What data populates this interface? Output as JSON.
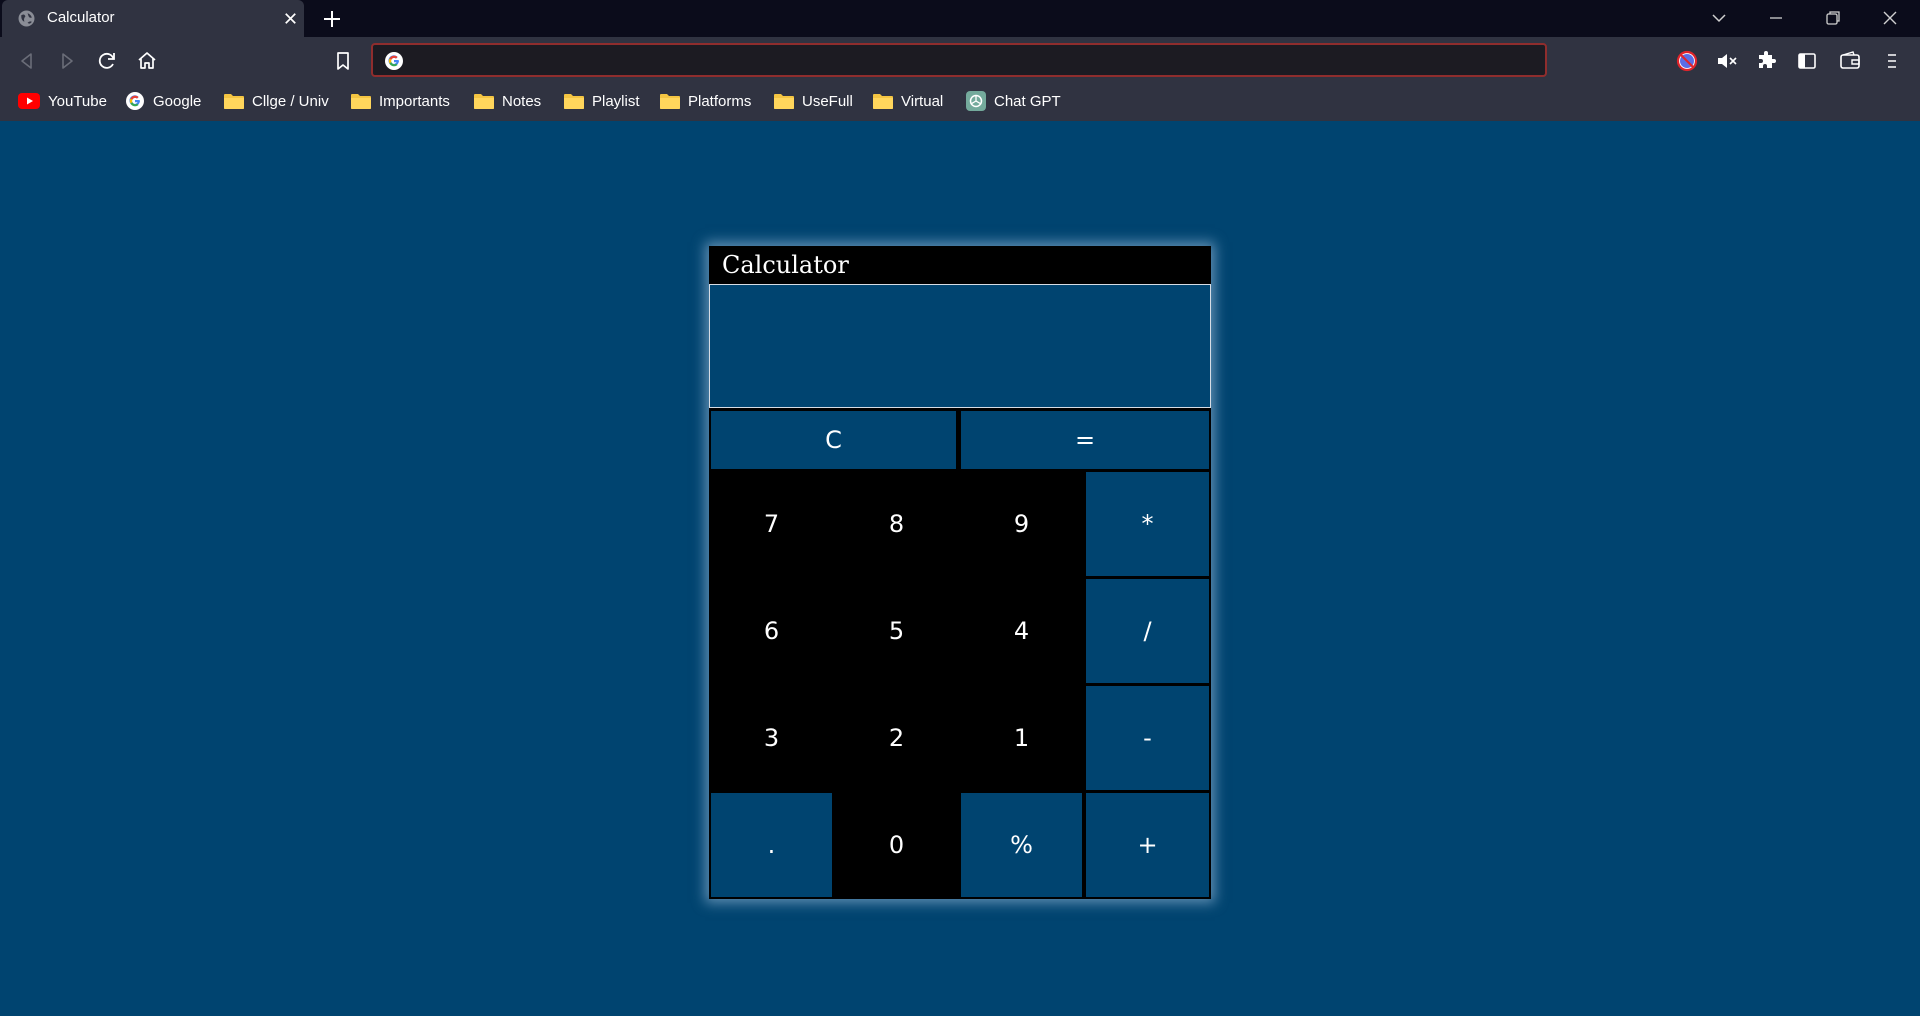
{
  "browser": {
    "tab_title": "Calculator",
    "address_value": "",
    "address_placeholder": "",
    "bookmarks": [
      "YouTube",
      "Google",
      "Cllge / Univ",
      "Importants",
      "Notes",
      "Playlist",
      "Platforms",
      "UseFull",
      "Virtual",
      "Chat GPT"
    ],
    "icons": {
      "tab": "globe-icon",
      "nav": [
        "back-icon",
        "forward-icon",
        "reload-icon",
        "home-icon",
        "bookmark-icon"
      ],
      "right": [
        "shield-blocked-icon",
        "mute-icon",
        "extensions-icon",
        "sidebar-icon",
        "wallet-icon",
        "menu-icon"
      ],
      "window": [
        "tab-list-icon",
        "minimize-icon",
        "restore-icon",
        "close-icon"
      ]
    }
  },
  "calculator": {
    "title": "Calculator",
    "display_value": "",
    "keys": {
      "clear": "C",
      "equals": "=",
      "k7": "7",
      "k8": "8",
      "k9": "9",
      "multiply": "*",
      "k6": "6",
      "k5": "5",
      "k4": "4",
      "divide": "/",
      "k3": "3",
      "k2": "2",
      "k1": "1",
      "subtract": "-",
      "dot": ".",
      "k0": "0",
      "percent": "%",
      "add": "+"
    }
  },
  "colors": {
    "page_background": "#004470",
    "key_blue": "#004470",
    "key_black": "#000000",
    "browser_dark": "#0b0c1b",
    "toolbar": "#303341"
  }
}
